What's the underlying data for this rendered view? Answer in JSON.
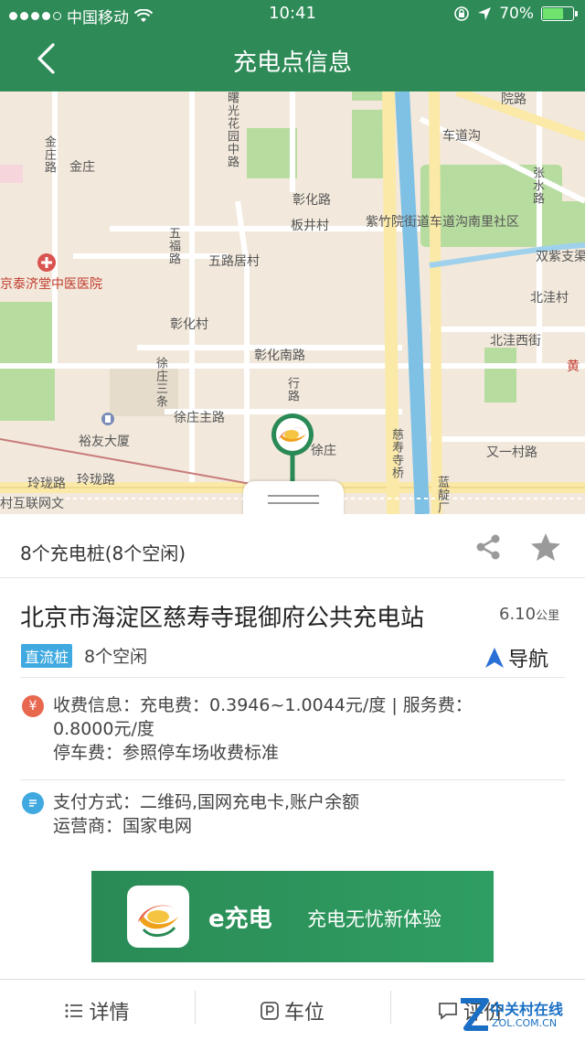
{
  "status_bar": {
    "carrier": "中国移动",
    "time": "10:41",
    "battery": "70%",
    "battery_level": 0.7
  },
  "header": {
    "title": "充电点信息"
  },
  "map": {
    "labels": {
      "jinzhuang_road": "金庄路",
      "jinzhuang": "金庄",
      "shuguang": "曙光花园中路",
      "chedaogou": "车道沟",
      "yuanlu": "院路",
      "zhangshu": "张水路",
      "zhanghua_road": "彰化路",
      "banjingcun": "板井村",
      "zizhuyuan": "紫竹院街道车道沟南里社区",
      "shuangyu": "双紫支渠",
      "wufu": "五福路",
      "wulu": "五路居村",
      "taiji_hospital": "京泰济堂中医医院",
      "beiwacun": "北洼村",
      "zhanghuacun": "彰化村",
      "beiwa_west": "北洼西街",
      "huang": "黄",
      "zhanghua_south": "彰化南路",
      "xuzhuang_3": "徐庄三条",
      "xingroad": "行路",
      "xuzhuang_main": "徐庄主路",
      "yuyou": "裕友大厦",
      "xuzhuang": "徐庄",
      "cishouqiao": "慈寿寺桥",
      "youyi": "又一村路",
      "linglong1": "玲珑路",
      "linglong2": "玲珑路",
      "lanzhang": "蓝靛厂",
      "hulian": "村互联网文"
    }
  },
  "summary": {
    "pile_count": "8个充电桩(8个空闲)"
  },
  "station": {
    "name": "北京市海淀区慈寿寺琨御府公共充电站",
    "distance_value": "6.10",
    "distance_unit": "公里",
    "type_badge": "直流桩",
    "free_count": "8个空闲",
    "navigate_label": "导航",
    "fee_line1": "收费信息：充电费：0.3946~1.0044元/度 | 服务费：",
    "fee_line2": "0.8000元/度",
    "parking_fee": "停车费：参照停车场收费标准",
    "payment": "支付方式：二维码,国网充电卡,账户余额",
    "operator": "运营商：国家电网",
    "fee_icon": "¥"
  },
  "banner": {
    "brand": "e充电",
    "slogan": "充电无忧新体验"
  },
  "tabs": [
    {
      "label": "详情"
    },
    {
      "label": "车位"
    },
    {
      "label": "评价"
    }
  ],
  "watermark": {
    "main": "中关村在线",
    "sub": "ZOL.COM.CN"
  },
  "colors": {
    "brand_green": "#2e8b57",
    "accent_blue": "#3fa9e0",
    "fee_icon_red": "#e8674f",
    "nav_arrow_blue": "#2a6fd6"
  }
}
